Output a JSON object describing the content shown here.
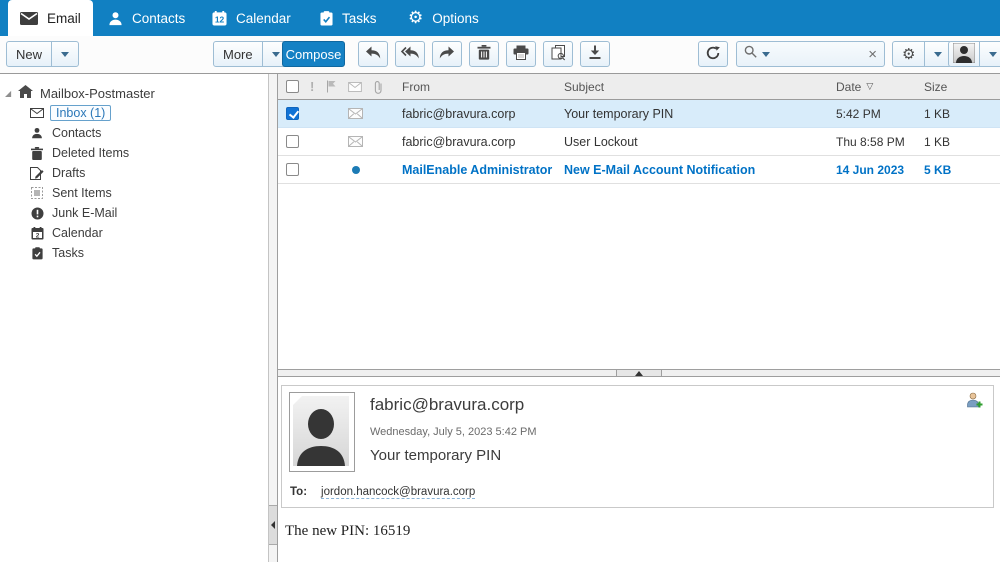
{
  "tabbar": {
    "tabs": [
      {
        "label": "Email",
        "icon": "email-icon",
        "active": true
      },
      {
        "label": "Contacts",
        "icon": "contacts-icon",
        "active": false
      },
      {
        "label": "Calendar",
        "icon": "calendar-icon",
        "active": false
      },
      {
        "label": "Tasks",
        "icon": "tasks-icon",
        "active": false
      },
      {
        "label": "Options",
        "icon": "options-gear-icon",
        "active": false
      }
    ]
  },
  "toolbar": {
    "new_label": "New",
    "more_label": "More",
    "compose_label": "Compose",
    "search_value": "",
    "search_placeholder": "",
    "icon_buttons": [
      "reply-icon",
      "reply-all-icon",
      "forward-icon",
      "delete-icon",
      "print-icon",
      "copy-view-icon",
      "download-icon",
      "refresh-icon",
      "settings-gear-icon",
      "account-avatar-icon"
    ]
  },
  "sidebar": {
    "root_label": "Mailbox-Postmaster",
    "items": [
      {
        "label": "Inbox (1)",
        "icon": "inbox-envelope-icon",
        "selected": true,
        "unread_count": 1
      },
      {
        "label": "Contacts",
        "icon": "contacts-person-icon",
        "selected": false
      },
      {
        "label": "Deleted Items",
        "icon": "trash-icon",
        "selected": false
      },
      {
        "label": "Drafts",
        "icon": "drafts-pencil-icon",
        "selected": false
      },
      {
        "label": "Sent Items",
        "icon": "sent-items-icon",
        "selected": false
      },
      {
        "label": "Junk E-Mail",
        "icon": "junk-exclamation-icon",
        "selected": false
      },
      {
        "label": "Calendar",
        "icon": "calendar-small-icon",
        "selected": false
      },
      {
        "label": "Tasks",
        "icon": "tasks-clipboard-icon",
        "selected": false
      }
    ]
  },
  "message_list": {
    "columns": {
      "from": "From",
      "subject": "Subject",
      "date": "Date",
      "size": "Size"
    },
    "sorted_by": "Date",
    "sort_descending": true,
    "header_icons": [
      "select-all-checkbox",
      "importance-icon",
      "flag-icon",
      "read-state-envelope-icon",
      "attachment-paperclip-icon"
    ],
    "rows": [
      {
        "checked": true,
        "selected": true,
        "unread": false,
        "from": "fabric@bravura.corp",
        "subject": "Your temporary PIN",
        "date": "5:42 PM",
        "size": "1 KB"
      },
      {
        "checked": false,
        "selected": false,
        "unread": false,
        "from": "fabric@bravura.corp",
        "subject": "User Lockout",
        "date": "Thu 8:58 PM",
        "size": "1 KB"
      },
      {
        "checked": false,
        "selected": false,
        "unread": true,
        "from": "MailEnable Administrator",
        "subject": "New E-Mail Account Notification",
        "date": "14 Jun 2023",
        "size": "5 KB"
      }
    ]
  },
  "preview": {
    "from": "fabric@bravura.corp",
    "datetime": "Wednesday, July 5, 2023 5:42 PM",
    "subject": "Your temporary PIN",
    "to_label": "To:",
    "to": "jordon.hancock@bravura.corp",
    "body": "The new PIN: 16519"
  },
  "colors": {
    "brand_blue": "#1180c2",
    "link_unread_blue": "#0072c6",
    "selected_row": "#d8ecfa",
    "compose_blue": "#1581c4"
  }
}
